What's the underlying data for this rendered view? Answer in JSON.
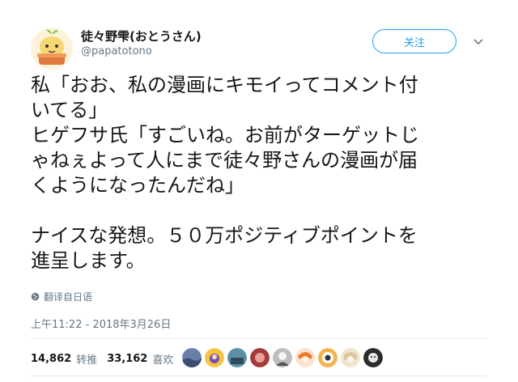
{
  "author": {
    "display_name": "徒々野雫(おとうさん)",
    "handle": "@papatotono"
  },
  "follow_label": "关注",
  "tweet": {
    "lines": [
      "私「おお、私の漫画にキモイってコメント付",
      "いてる」",
      "ヒゲフサ氏「すごいね。お前がターゲットじ",
      "ゃねぇよって人にまで徒々野さんの漫画が届",
      "くようになったんだね」",
      "",
      "ナイスな発想。５０万ポジティブポイントを",
      "進呈します。"
    ]
  },
  "translate_label": "翻译自日语",
  "timestamp": "上午11:22 - 2018年3月26日",
  "stats": {
    "retweets": "14,862",
    "retweets_label": "转推",
    "likes": "33,162",
    "likes_label": "喜欢"
  },
  "liker_avatars": [
    "liker-1",
    "liker-2",
    "liker-3",
    "liker-4",
    "liker-5",
    "liker-6",
    "liker-7",
    "liker-8",
    "liker-9"
  ],
  "colors": {
    "accent": "#1da1f2",
    "muted": "#657786",
    "divider": "#e6ecf0"
  }
}
